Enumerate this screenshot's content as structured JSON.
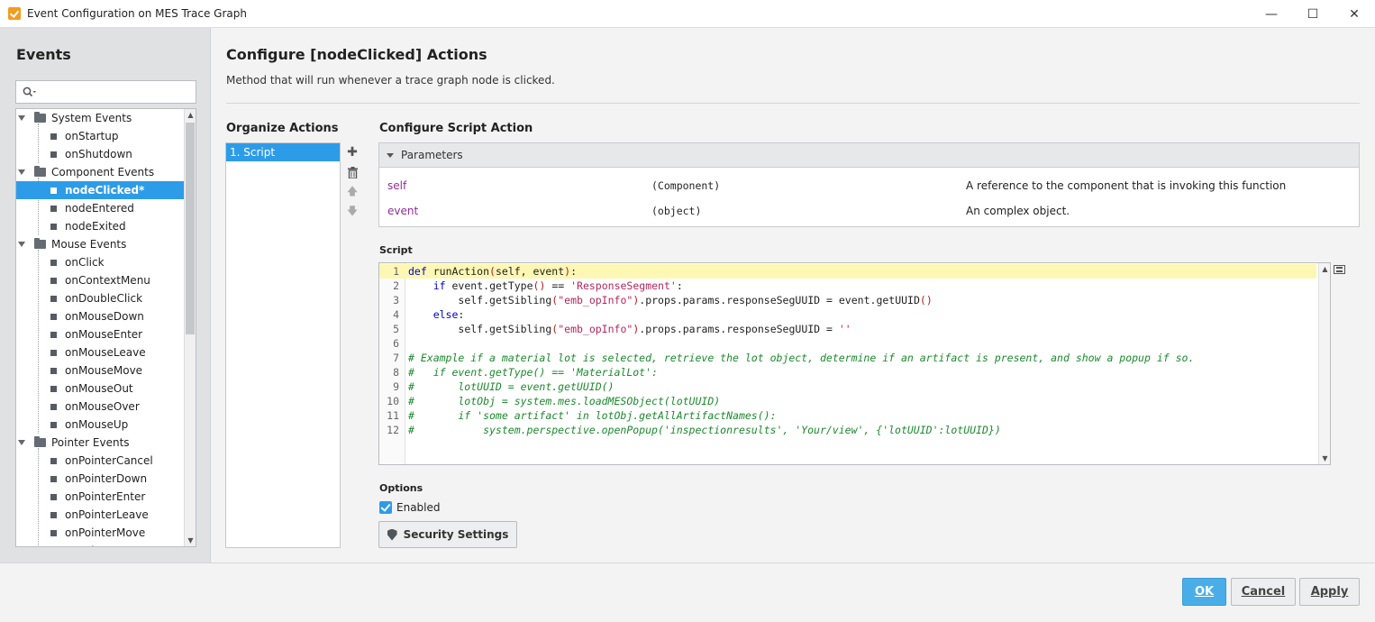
{
  "window": {
    "title": "Event Configuration on MES Trace Graph",
    "controls": [
      "—",
      "☐",
      "✕"
    ]
  },
  "sidebar": {
    "title": "Events",
    "search": {
      "placeholder": "",
      "value": ""
    },
    "groups": [
      {
        "label": "System Events",
        "items": [
          "onStartup",
          "onShutdown"
        ]
      },
      {
        "label": "Component Events",
        "items": [
          "nodeClicked*",
          "nodeEntered",
          "nodeExited"
        ]
      },
      {
        "label": "Mouse Events",
        "items": [
          "onClick",
          "onContextMenu",
          "onDoubleClick",
          "onMouseDown",
          "onMouseEnter",
          "onMouseLeave",
          "onMouseMove",
          "onMouseOut",
          "onMouseOver",
          "onMouseUp"
        ]
      },
      {
        "label": "Pointer Events",
        "items": [
          "onPointerCancel",
          "onPointerDown",
          "onPointerEnter",
          "onPointerLeave",
          "onPointerMove",
          "onPointerOut"
        ]
      }
    ],
    "selected": "nodeClicked*"
  },
  "main": {
    "title": "Configure [nodeClicked] Actions",
    "subtitle": "Method that will run whenever a trace graph node is clicked.",
    "organize": {
      "title": "Organize Actions",
      "items": [
        "1. Script"
      ]
    },
    "configure": {
      "title": "Configure Script Action",
      "parameters": {
        "header": "Parameters",
        "rows": [
          {
            "name": "self",
            "type": "(Component)",
            "desc": "A reference to the component that is invoking this function"
          },
          {
            "name": "event",
            "type": "(object)",
            "desc": "An complex object."
          }
        ]
      },
      "script_label": "Script",
      "script_lines": [
        "def runAction(self, event):",
        "    if event.getType() == 'ResponseSegment':",
        "        self.getSibling(\"emb_opInfo\").props.params.responseSegUUID = event.getUUID()",
        "    else:",
        "        self.getSibling(\"emb_opInfo\").props.params.responseSegUUID = ''",
        "",
        "# Example if a material lot is selected, retrieve the lot object, determine if an artifact is present, and show a popup if so.",
        "#   if event.getType() == 'MaterialLot':",
        "#       lotUUID = event.getUUID()",
        "#       lotObj = system.mes.loadMESObject(lotUUID)",
        "#       if 'some artifact' in lotObj.getAllArtifactNames():",
        "#           system.perspective.openPopup('inspectionresults', 'Your/view', {'lotUUID':lotUUID})"
      ],
      "options_label": "Options",
      "enabled_label": "Enabled",
      "enabled": true,
      "security_label": "Security Settings"
    }
  },
  "footer": {
    "ok": "OK",
    "cancel": "Cancel",
    "apply": "Apply"
  },
  "colors": {
    "accent": "#2d9ce8",
    "ok_button": "#49aee8",
    "keyword": "#0000cc",
    "string": "#b5265c",
    "comment": "#1c8a2e",
    "param_name": "#8e2f9a",
    "current_line": "#fdf7b4"
  }
}
